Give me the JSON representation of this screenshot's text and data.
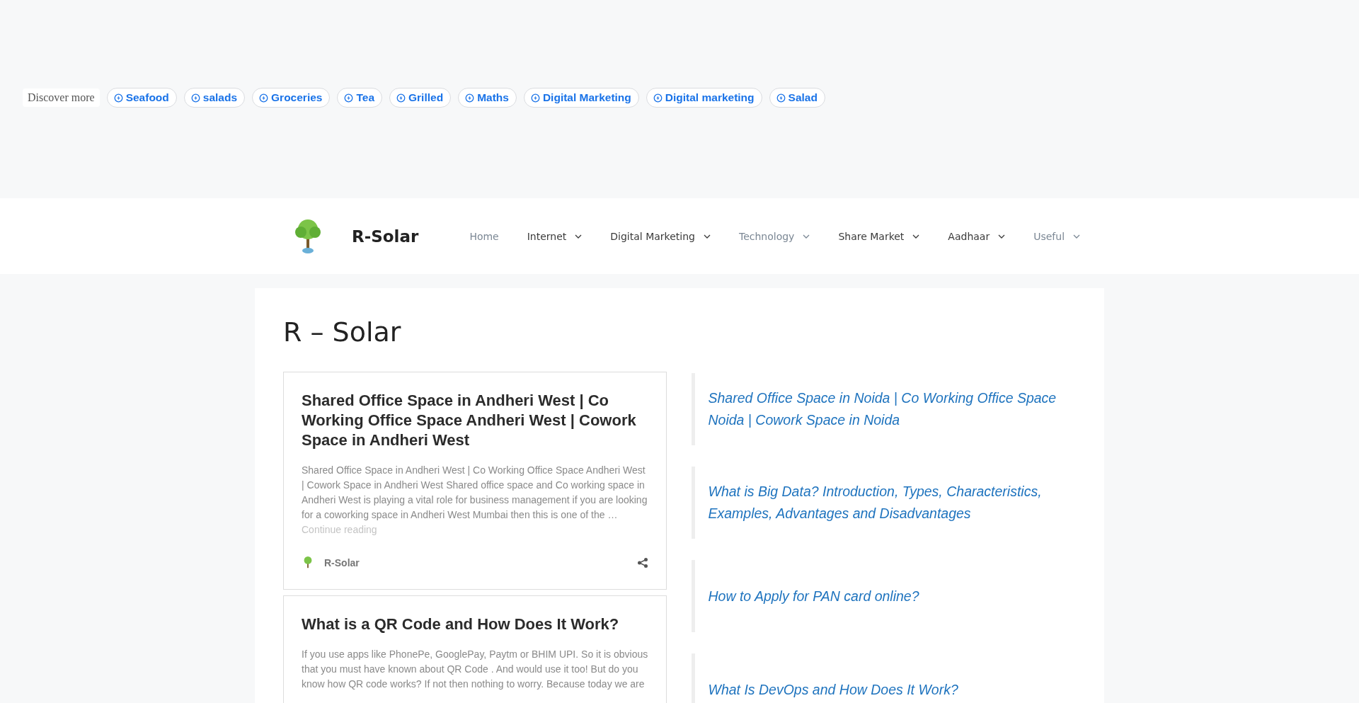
{
  "discover": {
    "label": "Discover more",
    "chips": [
      {
        "label": "Seafood"
      },
      {
        "label": "salads"
      },
      {
        "label": "Groceries"
      },
      {
        "label": "Tea"
      },
      {
        "label": "Grilled"
      },
      {
        "label": "Maths"
      },
      {
        "label": "Digital Marketing"
      },
      {
        "label": "Digital marketing"
      },
      {
        "label": "Salad"
      }
    ]
  },
  "header": {
    "site_title": "R-Solar",
    "nav": [
      {
        "label": "Home",
        "muted": true,
        "dropdown": false
      },
      {
        "label": "Internet",
        "muted": false,
        "dropdown": true
      },
      {
        "label": "Digital Marketing",
        "muted": false,
        "dropdown": true
      },
      {
        "label": "Technology",
        "muted": true,
        "dropdown": true
      },
      {
        "label": "Share Market",
        "muted": false,
        "dropdown": true
      },
      {
        "label": "Aadhaar",
        "muted": false,
        "dropdown": true
      },
      {
        "label": "Useful",
        "muted": true,
        "dropdown": true
      }
    ]
  },
  "page_title": "R – Solar",
  "posts": [
    {
      "title": "Shared Office Space in Andheri West | Co Working Office Space Andheri West | Cowork Space in Andheri West",
      "excerpt": "Shared Office Space in Andheri West | Co Working Office Space Andheri West | Cowork Space in Andheri West Shared office space and Co working space in Andheri West is playing a vital role for business management if you are looking for a coworking space in Andheri West Mumbai then this is one of the …",
      "more": "Continue reading",
      "author": "R-Solar"
    },
    {
      "title": "What is a QR Code and How Does It Work?",
      "excerpt": "If you use apps like PhonePe, GooglePay, Paytm or BHIM UPI. So it is obvious that you must have known about QR Code . And would use it too! But do you know how QR code works? If not then nothing to worry. Because today we are"
    }
  ],
  "sidebar_links": [
    {
      "label": "Shared Office Space in Noida | Co Working Office Space Noida | Cowork Space in Noida"
    },
    {
      "label": "What is Big Data? Introduction, Types, Characteristics, Examples, Advantages and Disadvantages"
    },
    {
      "label": "How to Apply for PAN card online?"
    },
    {
      "label": "What Is DevOps and How Does It Work?"
    }
  ]
}
